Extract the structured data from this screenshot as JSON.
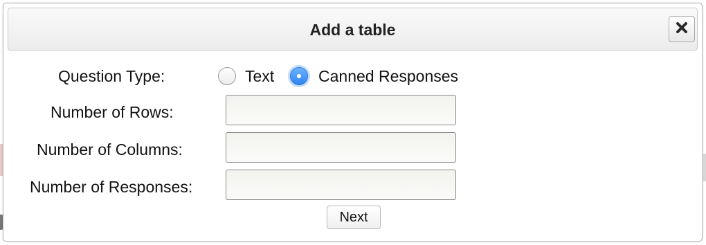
{
  "dialog": {
    "title": "Add a table",
    "close_icon": "close-icon"
  },
  "question_type": {
    "label": "Question Type:",
    "options": [
      {
        "label": "Text",
        "selected": false
      },
      {
        "label": "Canned Responses",
        "selected": true
      }
    ]
  },
  "fields": {
    "rows": {
      "label": "Number of Rows:",
      "value": ""
    },
    "columns": {
      "label": "Number of Columns:",
      "value": ""
    },
    "responses": {
      "label": "Number of Responses:",
      "value": ""
    }
  },
  "actions": {
    "next_label": "Next"
  },
  "colors": {
    "radio_selected": "#2f86f0",
    "titlebar_bg": "#f2f2f2"
  }
}
